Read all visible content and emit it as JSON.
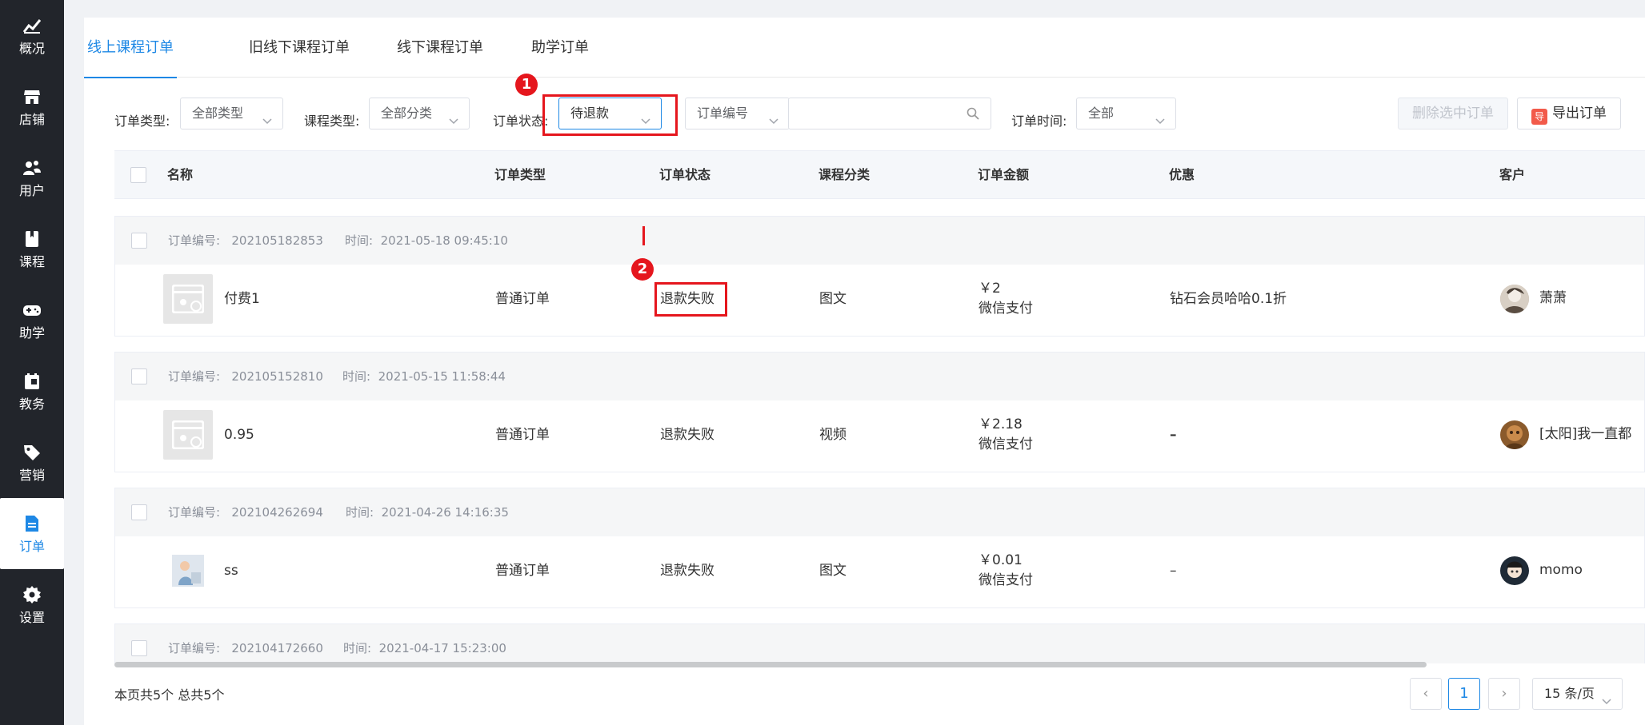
{
  "sidebar": {
    "items": [
      {
        "label": "概况",
        "icon": "chart-icon"
      },
      {
        "label": "店铺",
        "icon": "store-icon"
      },
      {
        "label": "用户",
        "icon": "users-icon"
      },
      {
        "label": "课程",
        "icon": "book-icon"
      },
      {
        "label": "助学",
        "icon": "gamepad-icon"
      },
      {
        "label": "教务",
        "icon": "calendar-icon"
      },
      {
        "label": "营销",
        "icon": "tag-icon"
      },
      {
        "label": "订单",
        "icon": "document-icon"
      },
      {
        "label": "设置",
        "icon": "gear-icon"
      }
    ],
    "active_index": 7
  },
  "tabs": [
    "线上课程订单",
    "旧线下课程订单",
    "线下课程订单",
    "助学订单"
  ],
  "filters": {
    "order_type_label": "订单类型:",
    "order_type_value": "全部类型",
    "course_type_label": "课程类型:",
    "course_type_value": "全部分类",
    "order_status_label": "订单状态:",
    "order_status_value": "待退款",
    "search_field_value": "订单编号",
    "search_value": "",
    "order_time_label": "订单时间:",
    "order_time_value": "全部"
  },
  "actions": {
    "delete_selected": "删除选中订单",
    "export_orders": "导出订单",
    "export_icon_text": "导"
  },
  "annotations": {
    "badge1": "1",
    "badge2": "2",
    "accent": "#e5161d"
  },
  "table": {
    "columns": [
      "名称",
      "订单类型",
      "订单状态",
      "课程分类",
      "订单金额",
      "优惠",
      "客户"
    ],
    "order_no_label": "订单编号:",
    "time_label": "时间:",
    "orders": [
      {
        "order_no": "202105182853",
        "time": "2021-05-18 09:45:10",
        "name": "付费1",
        "type": "普通订单",
        "status": "退款失败",
        "category": "图文",
        "amount": "￥2",
        "pay_method": "微信支付",
        "discount": "钻石会员哈哈0.1折",
        "customer": "萧萧"
      },
      {
        "order_no": "202105152810",
        "time": "2021-05-15 11:58:44",
        "name": "0.95",
        "type": "普通订单",
        "status": "退款失败",
        "category": "视频",
        "amount": "￥2.18",
        "pay_method": "微信支付",
        "discount": "–",
        "customer": "[太阳]我一直都"
      },
      {
        "order_no": "202104262694",
        "time": "2021-04-26 14:16:35",
        "name": "ss",
        "type": "普通订单",
        "status": "退款失败",
        "category": "图文",
        "amount": "￥0.01",
        "pay_method": "微信支付",
        "discount": "–",
        "customer": "momo"
      },
      {
        "order_no": "202104172660",
        "time": "2021-04-17 15:23:00"
      }
    ]
  },
  "footer": {
    "summary": "本页共5个 总共5个",
    "current_page": "1",
    "prev": "‹",
    "next": "›",
    "page_size": "15 条/页"
  },
  "colors": {
    "primary": "#1e88e5",
    "sidebar_bg": "#22252b",
    "highlight": "#e5161d"
  }
}
